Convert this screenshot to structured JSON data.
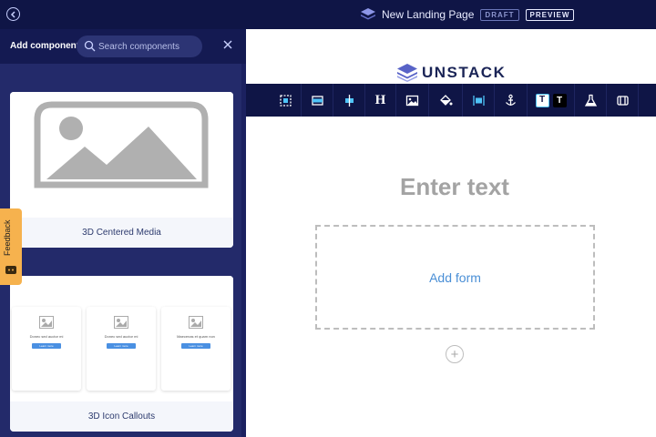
{
  "topbar": {
    "page_title": "New Landing Page",
    "draft_label": "DRAFT",
    "preview_label": "PREVIEW",
    "back_icon": "chevron-left-icon"
  },
  "sidebar": {
    "title": "Add component",
    "search": {
      "placeholder": "Search components",
      "value": ""
    },
    "cards": [
      {
        "label": "3D Centered Media"
      },
      {
        "label": "3D Icon Callouts"
      }
    ],
    "mini_cards": [
      {
        "text": "Donec sed auctor mi",
        "button": "Learn more"
      },
      {
        "text": "Donec sed auctor mi",
        "button": "Learn more"
      },
      {
        "text": "Maecenas et quam non",
        "button": "Learn more"
      }
    ]
  },
  "feedback": {
    "label": "Feedback"
  },
  "canvas": {
    "brand": "UNSTACK",
    "heading": "Enter text",
    "form_label": "Add form"
  },
  "toolbar": {
    "tools": [
      "select-icon",
      "media-icon",
      "align-icon",
      "heading-icon",
      "image-icon",
      "fill-icon",
      "width-icon",
      "anchor-icon",
      "text-style-icon",
      "flask-icon",
      "layout-icon"
    ],
    "heading_glyph": "H",
    "text_glyph_a": "T",
    "text_glyph_b": "T"
  },
  "colors": {
    "topbar_bg": "#0f1546",
    "sidebar_bg": "#232a6a",
    "feedback_bg": "#f6b24e",
    "link_blue": "#4a8fd6",
    "placeholder_gray": "#a3a3a3"
  }
}
